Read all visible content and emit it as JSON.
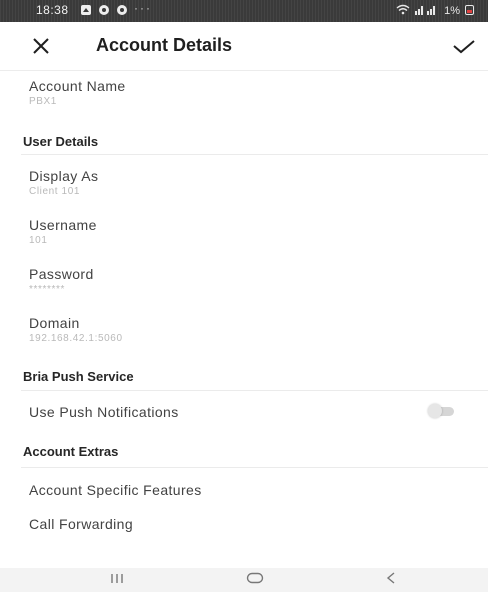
{
  "status_bar": {
    "time": "18:38",
    "dots": "···",
    "battery": "1%",
    "icons": [
      "notification-icon",
      "message-icon",
      "location-icon",
      "wifi-icon",
      "signal-icon",
      "battery-icon"
    ]
  },
  "app_bar": {
    "title": "Account Details",
    "close_icon": "close-icon",
    "save_icon": "checkmark-icon"
  },
  "account": {
    "name_label": "Account Name",
    "name_value": "PBX1"
  },
  "user_details": {
    "header": "User Details",
    "display_as_label": "Display As",
    "display_as_value": "Client 101",
    "username_label": "Username",
    "username_value": "101",
    "password_label": "Password",
    "password_value": "********",
    "domain_label": "Domain",
    "domain_value": "192.168.42.1:5060"
  },
  "push_service": {
    "header": "Bria Push Service",
    "push_label": "Use Push Notifications",
    "push_enabled": false
  },
  "account_extras": {
    "header": "Account Extras",
    "specific_features_label": "Account Specific Features",
    "call_forwarding_label": "Call Forwarding"
  },
  "nav_bar": {
    "recents_symbol": "|||",
    "home_symbol": "◯",
    "back_symbol": "<"
  },
  "colors": {
    "status_bar": "#3a3a3a",
    "text_primary": "#424242",
    "text_secondary": "#b9b9b9",
    "section_text": "#262626",
    "divider": "#ebebeb",
    "toggle_off": "#d6d6d6"
  }
}
